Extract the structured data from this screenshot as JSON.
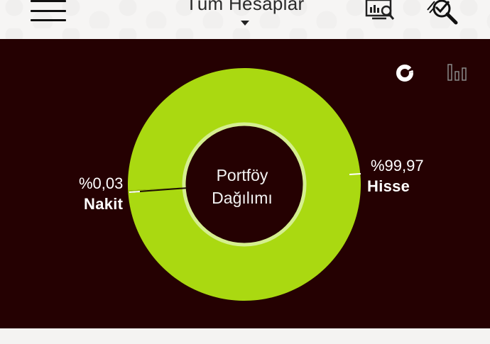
{
  "header": {
    "account_selector_label": "Tüm Hesaplar",
    "menu_icon": "hamburger-menu-icon",
    "market_screen_icon": "chart-monitor-search-icon",
    "analysis_icon": "magnifier-check-icon"
  },
  "view_toggle": {
    "donut_icon": "donut-chart-icon",
    "bar_icon": "bar-chart-icon",
    "active": "donut"
  },
  "chart": {
    "center_line1": "Portföy",
    "center_line2": "Dağılımı"
  },
  "chart_data": {
    "type": "pie",
    "title": "Portföy Dağılımı",
    "categories": [
      "Hisse",
      "Nakit"
    ],
    "values": [
      99.97,
      0.03
    ],
    "value_labels": [
      "%99,97",
      "%0,03"
    ],
    "colors": [
      "#aad911",
      "#aad911"
    ]
  },
  "colors": {
    "panel_bg": "#250102",
    "donut_green": "#aad911",
    "inner_ring": "#d5ef8f",
    "header_bg": "#f6f5f4"
  }
}
